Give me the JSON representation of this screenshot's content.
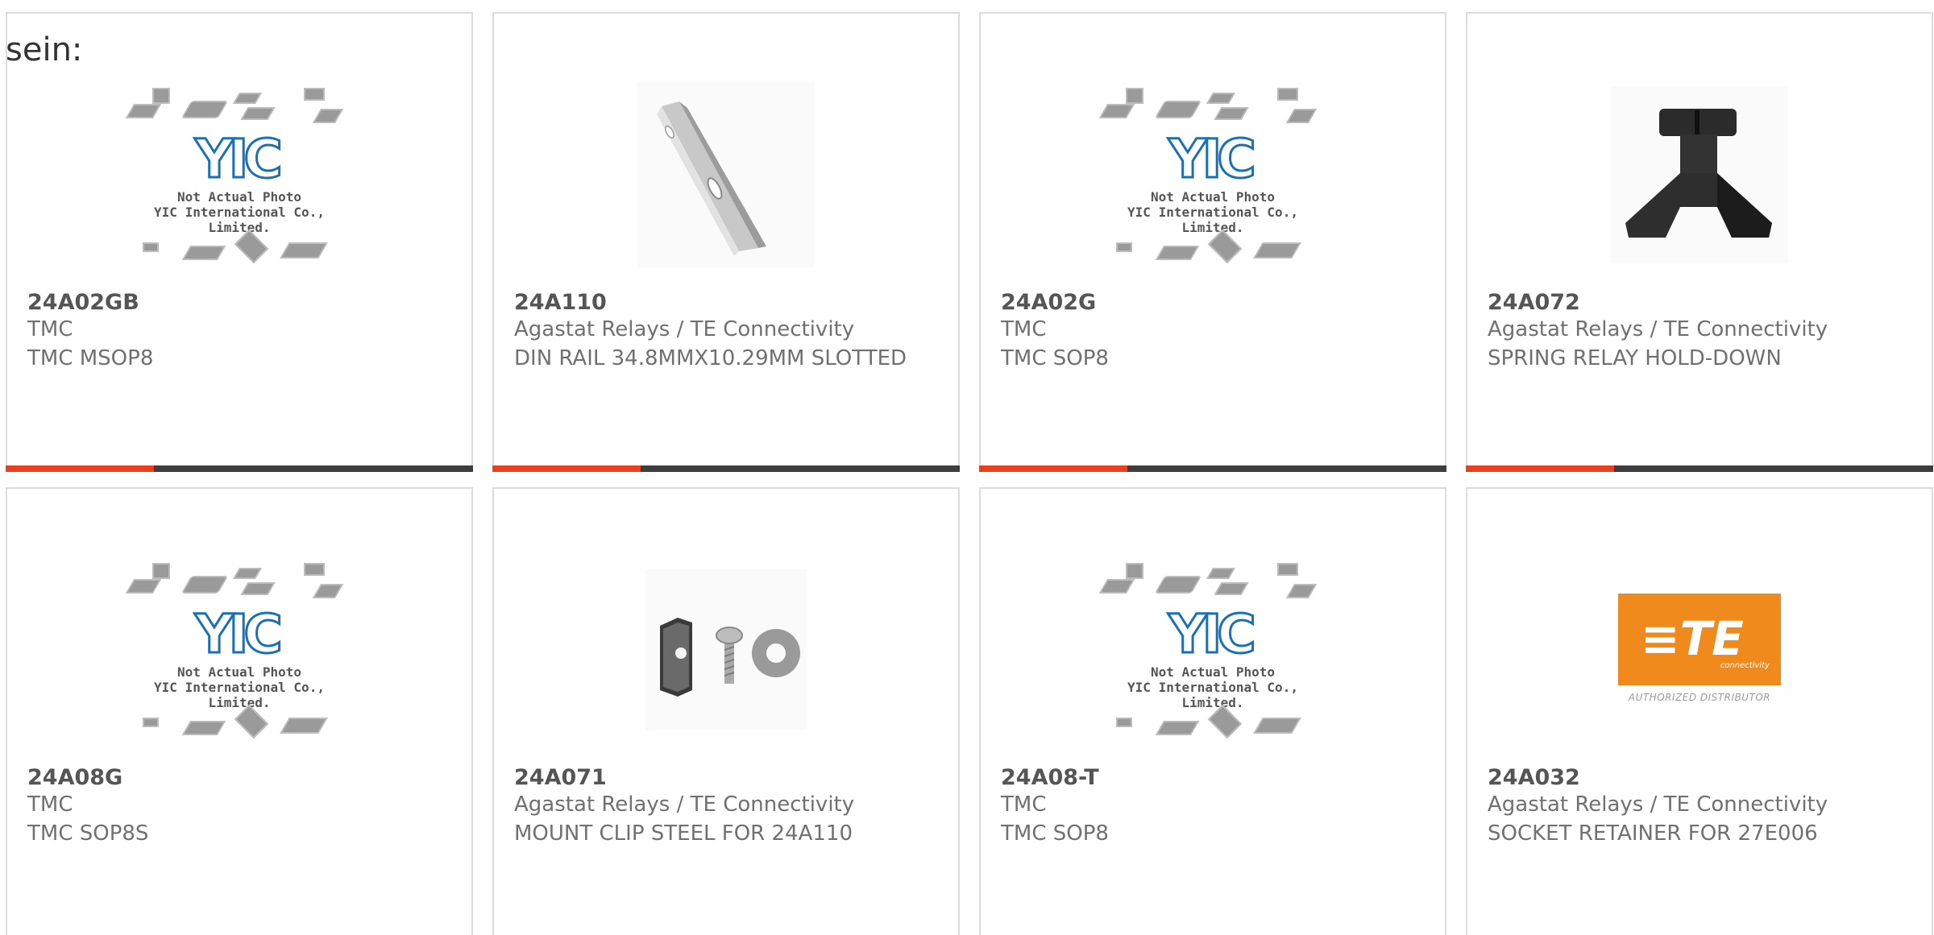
{
  "intro_text": "sein:",
  "placeholder": {
    "brand": "YIC",
    "line1": "Not Actual Photo",
    "line2": "YIC International Co., Limited."
  },
  "te_badge": {
    "mark": "≡TE",
    "sub": "connectivity",
    "auth": "AUTHORIZED DISTRIBUTOR"
  },
  "colors": {
    "accent": "#e8411f",
    "bar": "#3d3d3d",
    "te_orange": "#f08a1c",
    "yic_blue": "#1b6fb5"
  },
  "products": [
    {
      "part": "24A02GB",
      "manufacturer": "TMC",
      "description": "TMC MSOP8",
      "image": "yic-placeholder"
    },
    {
      "part": "24A110",
      "manufacturer": "Agastat Relays / TE Connectivity",
      "description": "DIN RAIL 34.8MMX10.29MM SLOTTED",
      "image": "din-rail-photo"
    },
    {
      "part": "24A02G",
      "manufacturer": "TMC",
      "description": "TMC SOP8",
      "image": "yic-placeholder"
    },
    {
      "part": "24A072",
      "manufacturer": "Agastat Relays / TE Connectivity",
      "description": "SPRING RELAY HOLD-DOWN",
      "image": "hold-down-photo"
    },
    {
      "part": "24A08G",
      "manufacturer": "TMC",
      "description": "TMC SOP8S",
      "image": "yic-placeholder"
    },
    {
      "part": "24A071",
      "manufacturer": "Agastat Relays / TE Connectivity",
      "description": "MOUNT CLIP STEEL FOR 24A110",
      "image": "mount-clip-photo"
    },
    {
      "part": "24A08-T",
      "manufacturer": "TMC",
      "description": "TMC SOP8",
      "image": "yic-placeholder"
    },
    {
      "part": "24A032",
      "manufacturer": "Agastat Relays / TE Connectivity",
      "description": "SOCKET RETAINER FOR 27E006",
      "image": "te-connectivity-logo"
    }
  ]
}
